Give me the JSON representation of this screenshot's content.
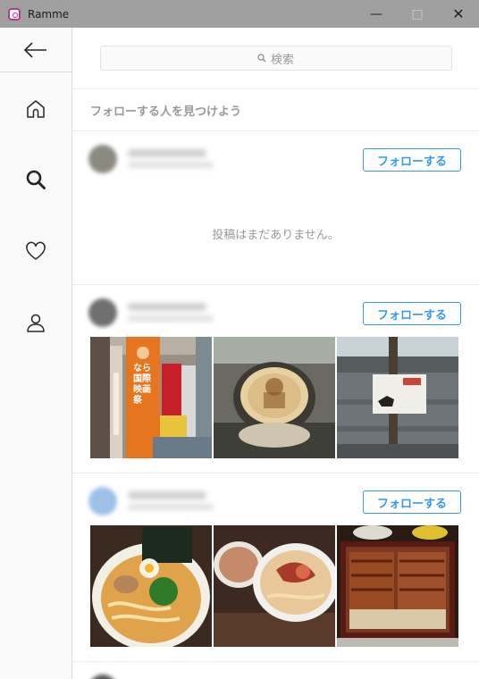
{
  "window": {
    "title": "Ramme",
    "minimize_glyph": "—",
    "maximize_glyph": "□",
    "close_glyph": "✕"
  },
  "search": {
    "placeholder": "検索"
  },
  "section_title": "フォローする人を見つけよう",
  "no_posts_text": "投稿はまだありません。",
  "follow_label": "フォローする",
  "suggestions": [
    {
      "has_posts": false,
      "avatar_color": "#8a8a80"
    },
    {
      "has_posts": true,
      "avatar_color": "#6f6f6f",
      "photos": [
        "station-banner",
        "wooden-coaster",
        "wall-poster"
      ]
    },
    {
      "has_posts": true,
      "avatar_color": "#9dc0e8",
      "photos": [
        "ramen-bowl",
        "tsukemen",
        "unagi-box"
      ]
    }
  ],
  "colors": {
    "accent": "#3897f0",
    "titlebar": "#a0a0a0"
  }
}
